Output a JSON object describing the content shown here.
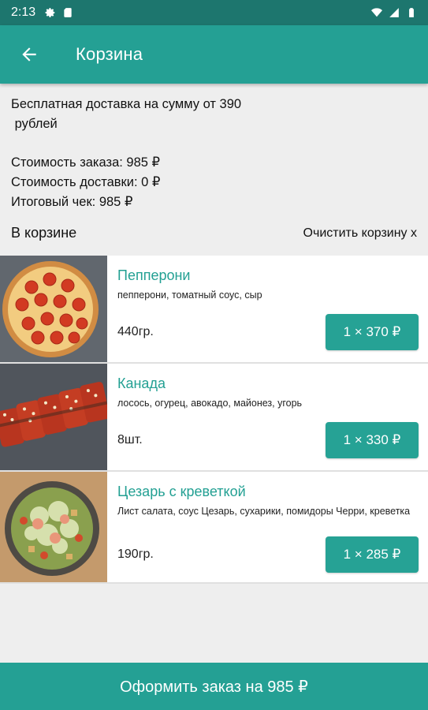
{
  "status_bar": {
    "time": "2:13"
  },
  "app_bar": {
    "title": "Корзина"
  },
  "info": {
    "delivery_note_line1": "Бесплатная доставка на сумму от 390",
    "delivery_note_line2": " рублей",
    "order_cost": "Стоимость заказа: 985 ₽",
    "delivery_cost": "Стоимость доставки: 0 ₽",
    "total": "Итоговый чек: 985 ₽"
  },
  "cart": {
    "label": "В корзине",
    "clear_label": "Очистить корзину x",
    "items": [
      {
        "name": "Пепперони",
        "description": "пепперони, томатный соус, сыр",
        "weight": "440гр.",
        "price_label": "1 × 370 ₽"
      },
      {
        "name": "Канада",
        "description": "лосось, огурец, авокадо, майонез, угорь",
        "weight": "8шт.",
        "price_label": "1 × 330 ₽"
      },
      {
        "name": "Цезарь с креветкой",
        "description": "Лист салата, соус Цезарь, сухарики, помидоры Черри, креветка",
        "weight": "190гр.",
        "price_label": "1 × 285 ₽"
      }
    ]
  },
  "checkout": {
    "label": "Оформить заказ на 985 ₽"
  },
  "colors": {
    "status_bar": "#1d766e",
    "accent": "#24a094",
    "background": "#eeeeee"
  }
}
